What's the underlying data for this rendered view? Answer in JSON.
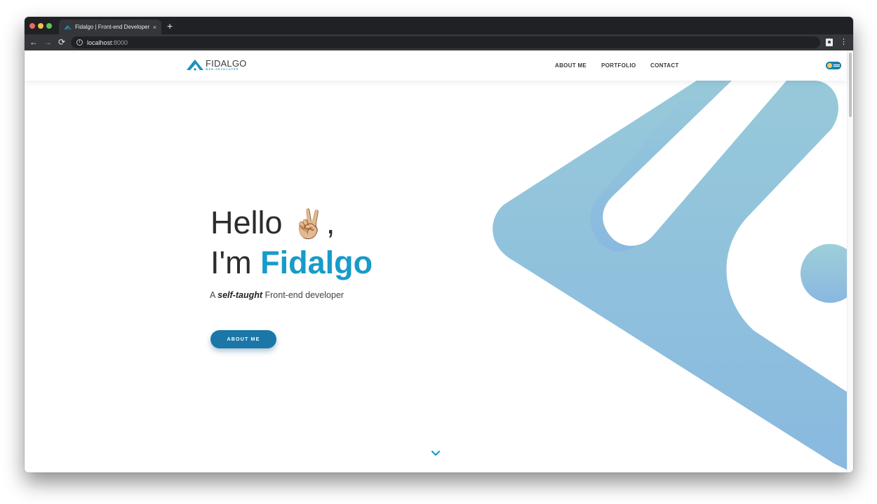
{
  "browser": {
    "tab_title": "Fidalgo | Front-end Developer",
    "tab_close": "×",
    "new_tab": "+",
    "back": "←",
    "forward": "→",
    "reload": "⟳",
    "url_host": "localhost",
    "url_port": ":8000",
    "menu": "⋮",
    "info": "i"
  },
  "header": {
    "logo_name": "FIDALGO",
    "logo_sub": "WEB DEVELOPER",
    "nav": [
      "ABOUT ME",
      "PORTFOLIO",
      "CONTACT"
    ]
  },
  "hero": {
    "hello": "Hello ",
    "emoji": "✌🏼",
    "comma": ",",
    "im": "I'm ",
    "name": "Fidalgo",
    "tagline_prefix": "A ",
    "tagline_emphasis": "self-taught",
    "tagline_suffix": " Front-end developer",
    "cta_label": "ABOUT ME"
  },
  "colors": {
    "accent": "#179bc9",
    "button": "#1a77a8",
    "deco_top": "#97c9da",
    "deco_bottom": "#89b9df",
    "browser_dark": "#202124",
    "browser_toolbar": "#35363a"
  },
  "icons": {
    "logo": "chevron-mountain-icon",
    "theme_toggle": "theme-toggle-icon",
    "scroll_down": "chevron-down-icon",
    "secure": "info-icon",
    "extension": "contact-card-icon"
  }
}
